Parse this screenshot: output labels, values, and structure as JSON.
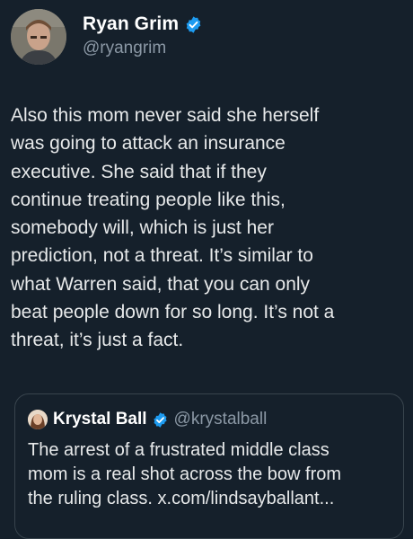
{
  "author": {
    "name": "Ryan Grim",
    "handle": "@ryangrim",
    "verified": true
  },
  "tweet": {
    "text": "Also this mom never said she herself\nwas going to attack an insurance\nexecutive. She said that if they\ncontinue treating people like this,\nsomebody will, which is just her\nprediction, not a threat. It’s similar to\nwhat Warren said, that you can only\nbeat people down for so long. It’s not a\nthreat, it’s just a fact."
  },
  "quoted_tweet": {
    "author_name": "Krystal Ball",
    "author_handle": "@krystalball",
    "verified": true,
    "text": "The arrest of a frustrated middle class\nmom is a real shot across the bow from\nthe ruling class. x.com/lindsayballant..."
  },
  "colors": {
    "background": "#15202b",
    "text": "#e7e9ea",
    "secondary_text": "#8b98a5",
    "verified_badge": "#1d9bf0",
    "card_border": "#38444d"
  },
  "icons": {
    "verified": "verified-badge-icon",
    "avatar": "author-avatar",
    "quote_avatar": "quoted-author-avatar"
  }
}
